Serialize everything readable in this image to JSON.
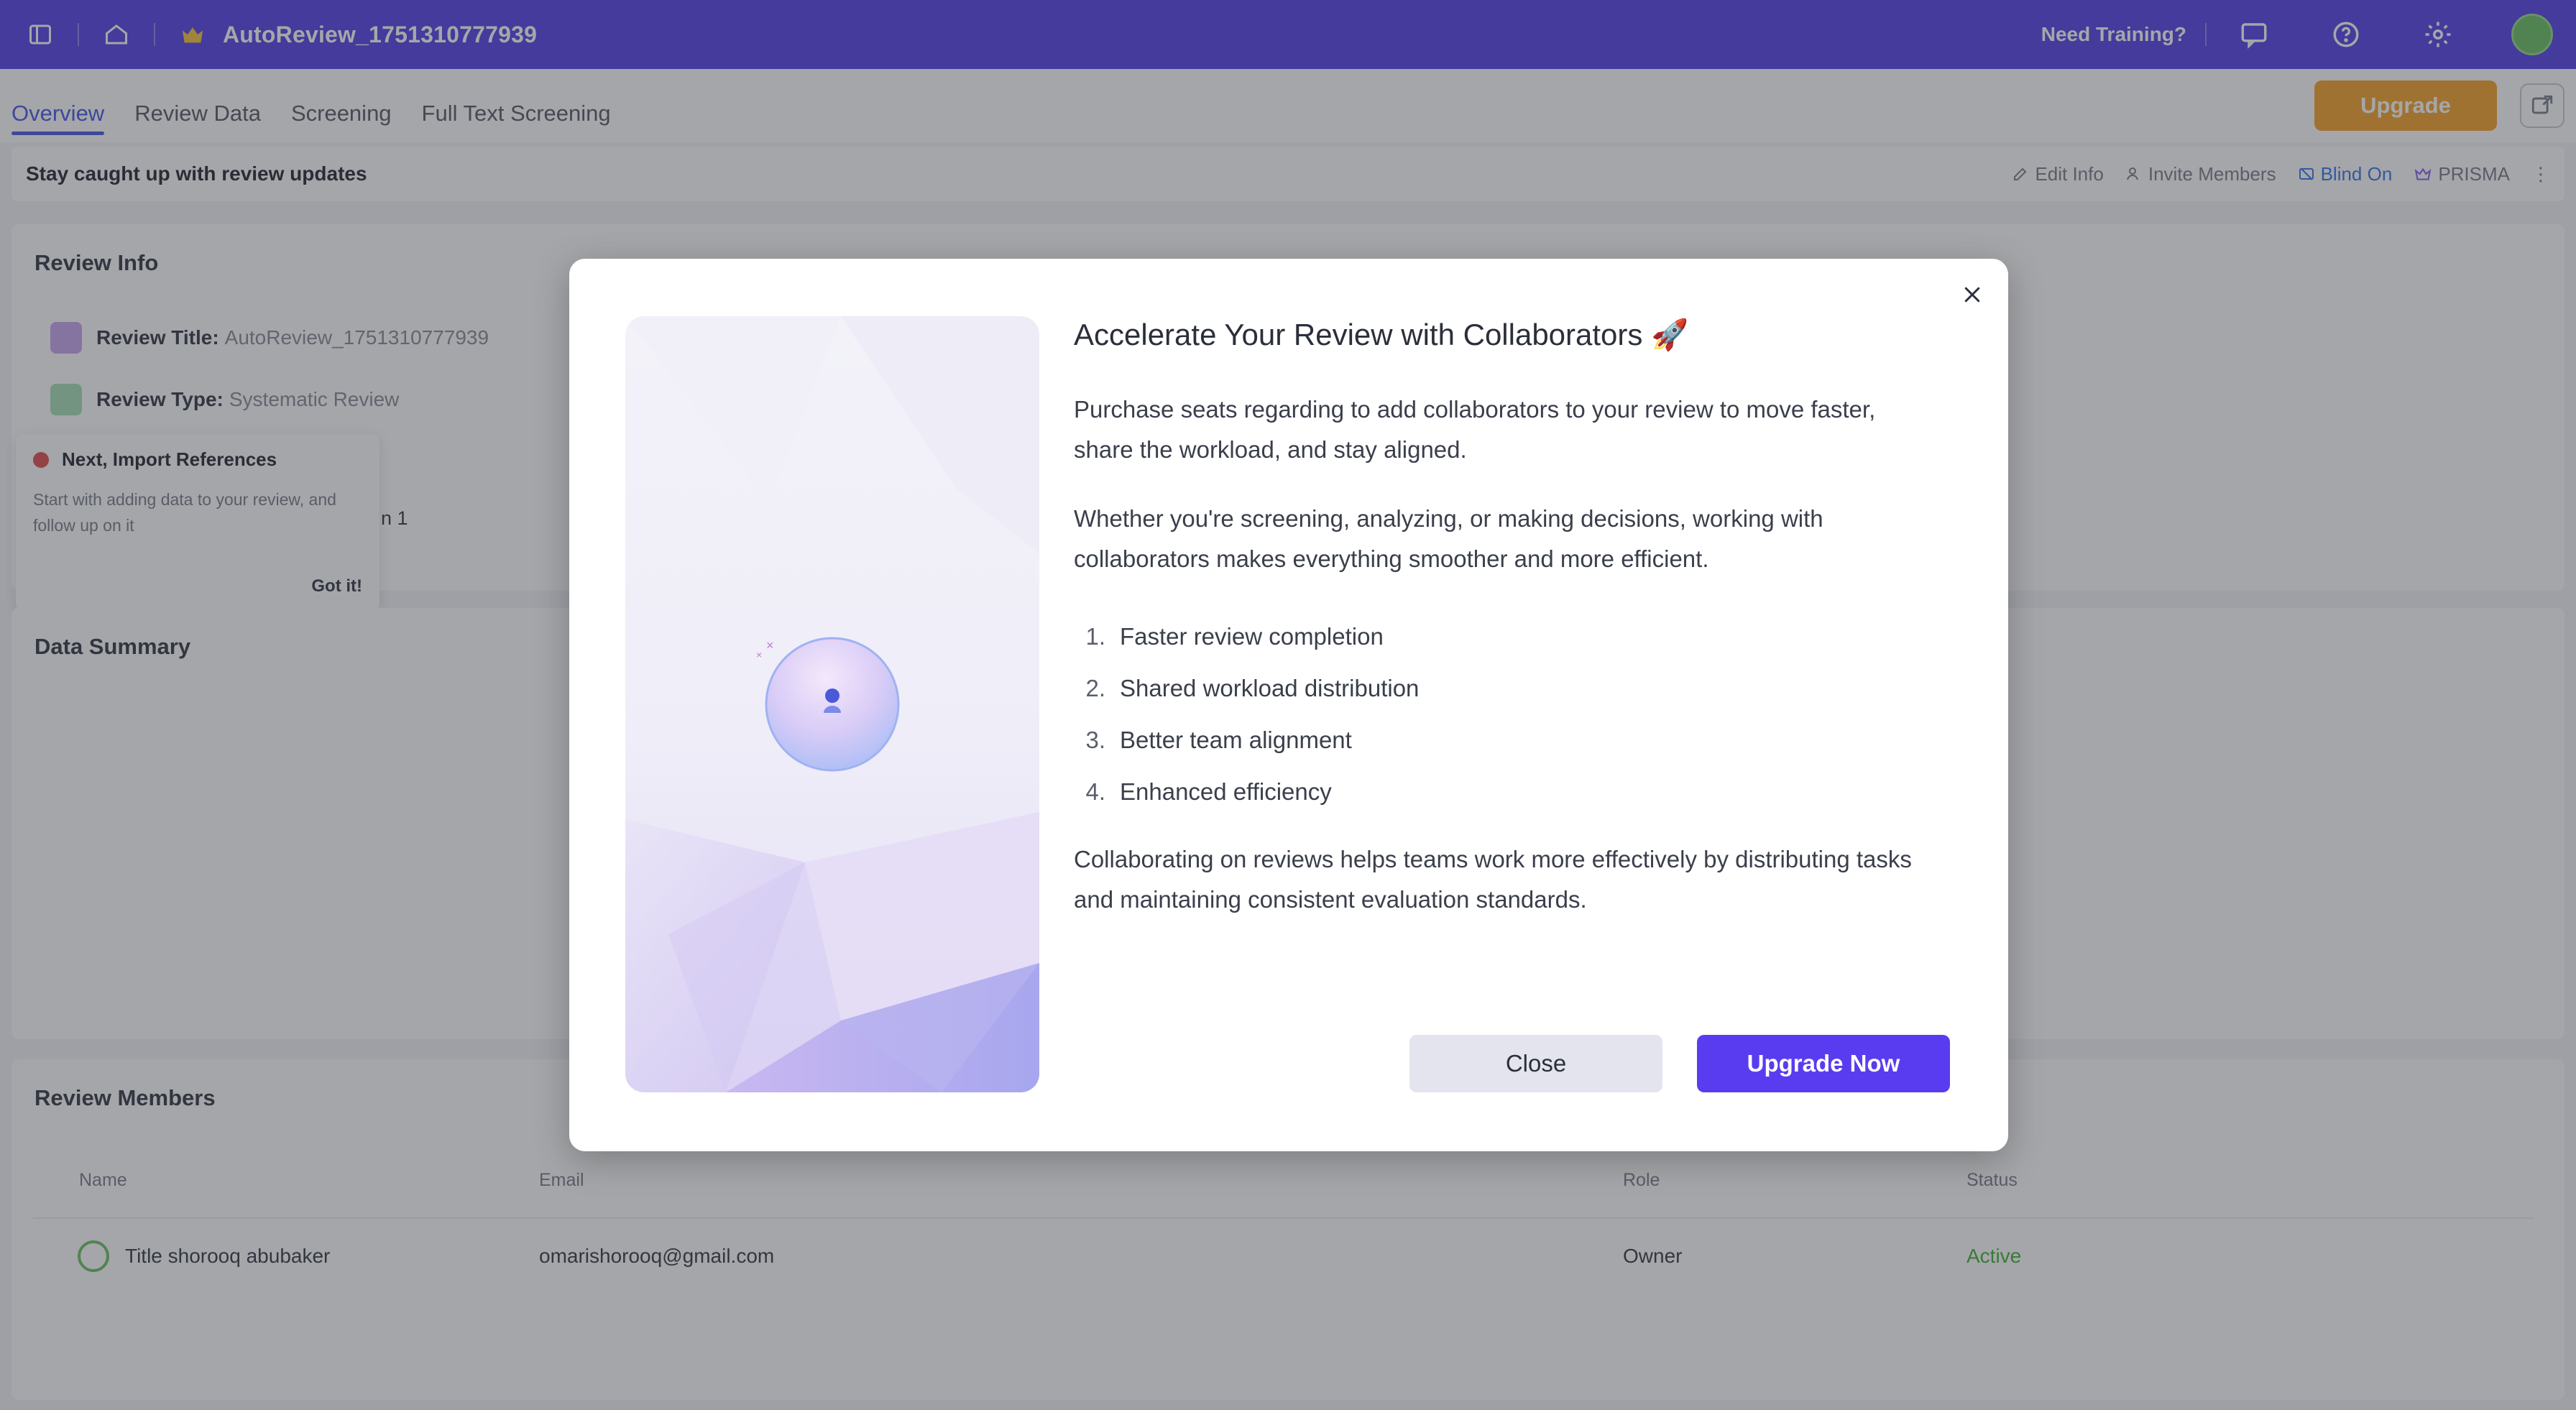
{
  "topbar": {
    "review_title": "AutoReview_1751310777939",
    "need_training": "Need Training?",
    "icons": [
      "sidebar-toggle-icon",
      "home-icon",
      "review-badge-icon",
      "chat-icon",
      "help-icon",
      "settings-icon"
    ]
  },
  "tabs": [
    {
      "label": "Overview",
      "active": true
    },
    {
      "label": "Review Data",
      "active": false
    },
    {
      "label": "Screening",
      "active": false
    },
    {
      "label": "Full Text Screening",
      "active": false
    }
  ],
  "upgrade_top_label": "Upgrade",
  "statusbar": {
    "message": "Stay caught up with review updates",
    "actions": [
      "Edit Info",
      "Invite Members",
      "Blind On",
      "PRISMA"
    ]
  },
  "review_info": {
    "title": "Review Info",
    "title_label": "Review Title:",
    "title_value": "AutoReview_1751310777939",
    "type_label": "Review Type:",
    "type_value": "Systematic Review",
    "stray_text": "n 1"
  },
  "tooltip": {
    "heading": "Next, Import References",
    "body": "Start with adding data to your review, and follow up on it",
    "button": "Got it!"
  },
  "data_summary": {
    "title": "Data Summary"
  },
  "members": {
    "title": "Review Members",
    "columns": [
      "Name",
      "Email",
      "Role",
      "Status"
    ],
    "rows": [
      {
        "name": "Title shorooq abubaker",
        "email": "omarishorooq@gmail.com",
        "role": "Owner",
        "status": "Active"
      }
    ]
  },
  "modal": {
    "title": "Accelerate Your Review with Collaborators 🚀",
    "para1": "Purchase seats regarding to add collaborators to your review to move faster, share the workload, and stay aligned.",
    "para2": "Whether you're screening, analyzing, or making decisions, working with collaborators makes everything smoother and more efficient.",
    "list": [
      {
        "num": "1.",
        "text": "Faster review completion"
      },
      {
        "num": "2.",
        "text": "Shared workload distribution"
      },
      {
        "num": "3.",
        "text": "Better team alignment"
      },
      {
        "num": "4.",
        "text": "Enhanced efficiency"
      }
    ],
    "para3": "Collaborating on reviews helps teams work more effectively by distributing tasks and maintaining consistent evaluation standards.",
    "close_label": "Close",
    "upgrade_label": "Upgrade Now"
  },
  "colors": {
    "topbar": "#5848e8",
    "accent": "#5a3cf0",
    "upgrade_orange": "#f7a531",
    "active_green": "#45b33b"
  }
}
